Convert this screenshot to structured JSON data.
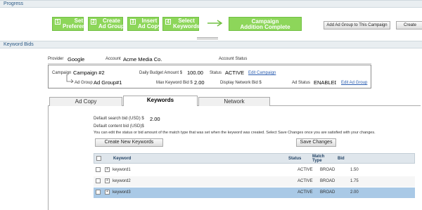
{
  "progress": {
    "title": "Progress",
    "steps": [
      {
        "num": "1",
        "label": "Set\nPreferences"
      },
      {
        "num": "2",
        "label": "Create\nAd Group"
      },
      {
        "num": "3",
        "label": "Insert\nAd Copy"
      },
      {
        "num": "4",
        "label": "Select\nKeywords"
      }
    ],
    "final_step": "Campaign\nAddition Complete",
    "add_group_button": "Add Ad Group to This Campaign",
    "create_button": "Create"
  },
  "keyword_bids": {
    "title": "Keyword Bids",
    "provider_label": "Provider",
    "provider_value": "Google",
    "account_label": "Account",
    "account_value": "Acme Media Co.",
    "account_status_label": "Account Status",
    "campaign_label": "Campaign",
    "campaign_value": "Campaign #2",
    "daily_budget_label": "Daily Budget Amount $",
    "daily_budget_value": "100.00",
    "status_label": "Status",
    "status_value": "ACTIVE",
    "edit_campaign_link": "Edit Campaign",
    "ad_group_label": "Ad Group",
    "ad_group_value": "Ad Group#1",
    "max_bid_label": "Max Keyword Bid $",
    "max_bid_value": "2.00",
    "display_network_label": "Display Network Bid $",
    "ad_status_label": "Ad Status",
    "ad_status_value": "ENABLED",
    "edit_ad_group_link": "Edit Ad Group"
  },
  "tabs": [
    {
      "label": "Ad Copy",
      "active": false
    },
    {
      "label": "Keywords",
      "active": true
    },
    {
      "label": "Network",
      "active": false
    }
  ],
  "keywords_panel": {
    "default_search_label": "Default search bid (USD) $",
    "default_search_value": "2.00",
    "default_content_label": "Default content bid (USD)$",
    "instructions": "You can edit the status or bid amount of the match type that was set when the keyword was created. Select Save Changes once you are satisfied with your changes.",
    "create_button": "Create New Keywords",
    "save_button": "Save Changes",
    "columns": [
      "Keyword",
      "Status",
      "Match Type",
      "Bid"
    ],
    "rows": [
      {
        "keyword": "keyword1",
        "status": "ACTIVE",
        "match": "BROAD",
        "bid": "1.50"
      },
      {
        "keyword": "keyword2",
        "status": "ACTIVE",
        "match": "BROAD",
        "bid": "1.75"
      },
      {
        "keyword": "keyword3",
        "status": "ACTIVE",
        "match": "BROAD",
        "bid": "2.00"
      }
    ]
  },
  "colors": {
    "step_green": "#8dd65a",
    "link_blue": "#2a5db0",
    "selected_row": "#a9c9e6"
  }
}
